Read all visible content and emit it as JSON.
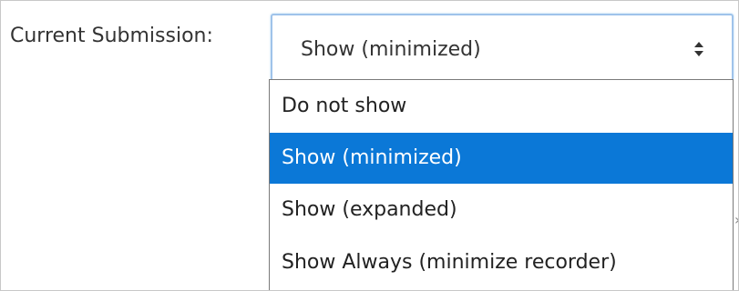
{
  "form": {
    "label": "Current Submission:",
    "select": {
      "value": "Show (minimized)",
      "icon": "sort-arrows-icon",
      "focus_color": "#9fc3ea"
    }
  },
  "dropdown": {
    "options": [
      "Do not show",
      "Show (minimized)",
      "Show (expanded)",
      "Show Always (minimize recorder)"
    ],
    "selected_index": 1,
    "highlight_color": "#0b78d7"
  }
}
